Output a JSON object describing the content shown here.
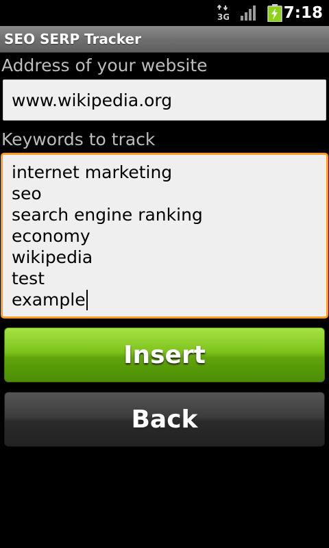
{
  "status_bar": {
    "network": "3G",
    "time": "7:18",
    "icons": [
      "3g-data-icon",
      "signal-strength-icon",
      "battery-charging-icon"
    ]
  },
  "app": {
    "title": "SEO SERP Tracker"
  },
  "form": {
    "address_label": "Address of your website",
    "address_value": "www.wikipedia.org",
    "keywords_label": "Keywords to track",
    "keywords": [
      "internet marketing",
      "seo",
      "search engine ranking",
      "economy",
      "wikipedia",
      "test",
      "example"
    ]
  },
  "buttons": {
    "insert_label": "Insert",
    "back_label": "Back"
  },
  "colors": {
    "focus_border": "#ff9a1e",
    "insert_green": "#7dc31a",
    "battery_green": "#8ed21b"
  }
}
